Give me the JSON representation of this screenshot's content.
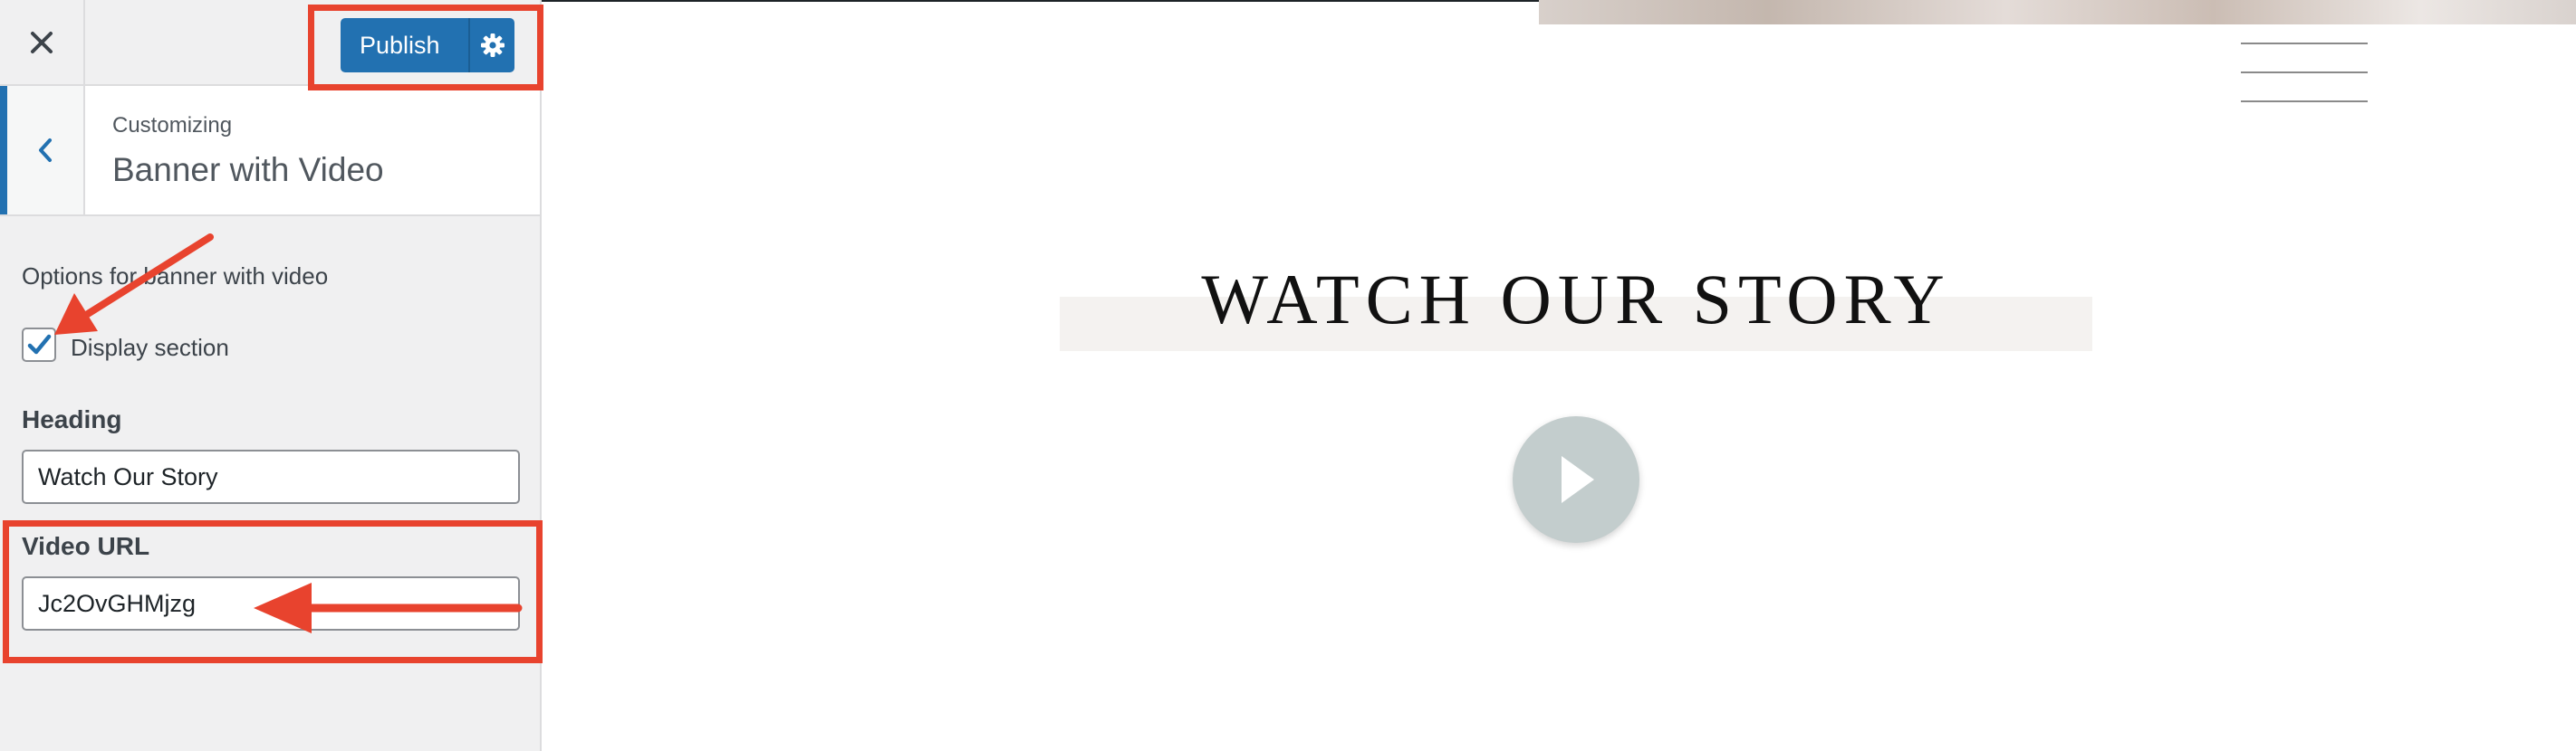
{
  "topbar": {
    "close_icon": "close-icon",
    "publish_label": "Publish",
    "settings_icon": "gear-icon"
  },
  "section": {
    "back_icon": "chevron-left-icon",
    "customizing_label": "Customizing",
    "title": "Banner with Video"
  },
  "controls": {
    "description": "Options for banner with video",
    "display_checkbox": {
      "label": "Display section",
      "checked": true
    },
    "heading_field": {
      "label": "Heading",
      "value": "Watch Our Story"
    },
    "video_url_field": {
      "label": "Video URL",
      "value": "Jc2OvGHMjzg"
    }
  },
  "preview": {
    "heading": "Watch Our Story",
    "play_icon": "play-icon",
    "menu_icon": "hamburger-menu-icon"
  },
  "colors": {
    "accent": "#2271b1",
    "annotation": "#e8432e",
    "play_button": "#c3cdcd",
    "sidebar_bg": "#f0f0f1"
  }
}
